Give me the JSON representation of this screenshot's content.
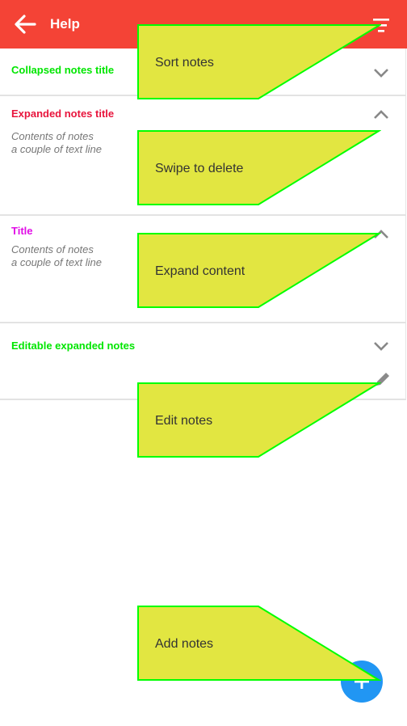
{
  "appbar": {
    "title": "Help",
    "back_icon": "arrow-left-icon",
    "sort_icon": "sort-icon",
    "color": "#f44336"
  },
  "notes": [
    {
      "title": "Collapsed notes title",
      "title_color": "#00e600",
      "expanded": false,
      "body_lines": []
    },
    {
      "title": "Expanded notes title",
      "title_color": "#e8143c",
      "expanded": true,
      "body_lines": [
        "Contents of notes",
        "a couple of text line"
      ]
    },
    {
      "title": "Title",
      "title_color": "#e10ce6",
      "expanded": true,
      "body_lines": [
        "Contents of notes",
        "a couple of text line"
      ]
    },
    {
      "title": "Editable expanded notes",
      "title_color": "#00e600",
      "expanded": false,
      "editable": true,
      "body_lines": []
    }
  ],
  "callouts": {
    "sort": "Sort notes",
    "swipe": "Swipe to delete",
    "expand": "Expand content",
    "edit": "Edit notes",
    "add": "Add notes"
  },
  "colors": {
    "callout_fill": "#e2e641",
    "callout_stroke": "#00ff00",
    "fab": "#2196f3"
  }
}
